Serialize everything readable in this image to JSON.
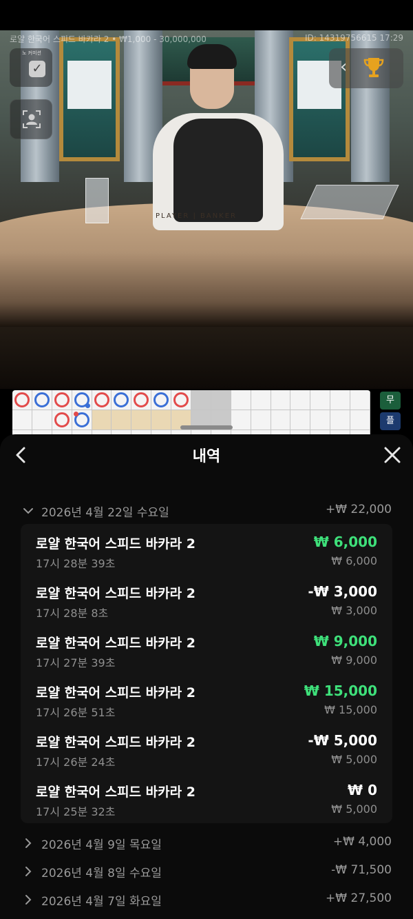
{
  "stage": {
    "game_title": "로얄 한국어 스피드 바카라 2 • ₩1,000 - 30,000,000",
    "game_id": "ID: 14319756615 17:29",
    "no_commission_label": "노 커미션",
    "table_text": "PLAYER | BANKER"
  },
  "road": {
    "side_stats": [
      "무",
      "플"
    ]
  },
  "sheet": {
    "title": "내역",
    "expanded_day": {
      "date": "2026년 4월 22일 수요일",
      "total": "+₩ 22,000",
      "entries": [
        {
          "name": "로얄 한국어 스피드 바카라 2",
          "time": "17시 28분 39초",
          "amount": "₩ 6,000",
          "stake": "₩ 6,000",
          "status": "win"
        },
        {
          "name": "로얄 한국어 스피드 바카라 2",
          "time": "17시 28분 8초",
          "amount": "-₩ 3,000",
          "stake": "₩ 3,000",
          "status": "loss"
        },
        {
          "name": "로얄 한국어 스피드 바카라 2",
          "time": "17시 27분 39초",
          "amount": "₩ 9,000",
          "stake": "₩ 9,000",
          "status": "win"
        },
        {
          "name": "로얄 한국어 스피드 바카라 2",
          "time": "17시 26분 51초",
          "amount": "₩ 15,000",
          "stake": "₩ 15,000",
          "status": "win"
        },
        {
          "name": "로얄 한국어 스피드 바카라 2",
          "time": "17시 26분 24초",
          "amount": "-₩ 5,000",
          "stake": "₩ 5,000",
          "status": "loss"
        },
        {
          "name": "로얄 한국어 스피드 바카라 2",
          "time": "17시 25분 32초",
          "amount": "₩ 0",
          "stake": "₩ 5,000",
          "status": "push"
        }
      ]
    },
    "collapsed_days": [
      {
        "date": "2026년 4월 9일 목요일",
        "total": "+₩ 4,000"
      },
      {
        "date": "2026년 4월 8일 수요일",
        "total": "-₩ 71,500"
      },
      {
        "date": "2026년 4월 7일 화요일",
        "total": "+₩ 27,500"
      }
    ]
  },
  "colors": {
    "win": "#3ee07a",
    "banker_red": "#e24b4b",
    "player_blue": "#3a6fd6"
  }
}
